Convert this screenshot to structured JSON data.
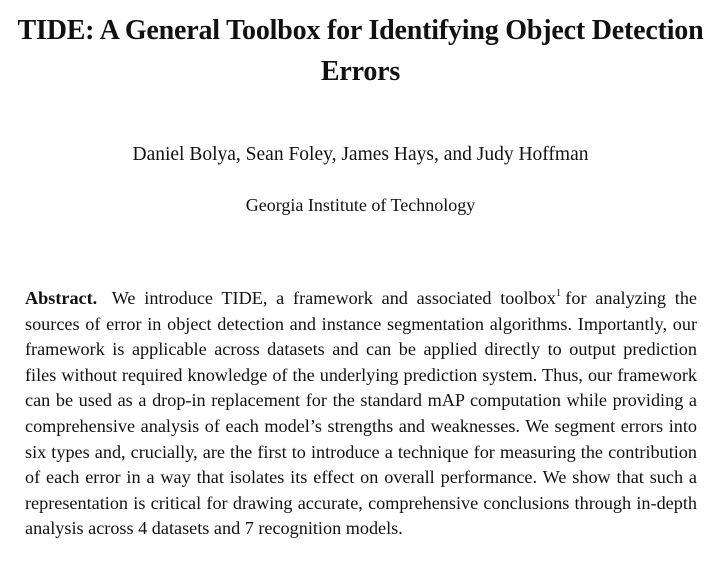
{
  "paper": {
    "title": "TIDE: A General Toolbox for Identifying Object Detection Errors",
    "authors": "Daniel Bolya, Sean Foley, James Hays, and Judy Hoffman",
    "affiliation": "Georgia Institute of Technology",
    "abstract": {
      "label": "Abstract.",
      "text_before_footnote": "We introduce TIDE, a framework and associated toolbox",
      "footnote_mark": "1",
      "text_after_footnote": "for analyzing the sources of error in object detection and instance segmentation algorithms. Importantly, our framework is applicable across datasets and can be applied directly to output prediction files without required knowledge of the underlying prediction system. Thus, our framework can be used as a drop-in replacement for the standard mAP computation while providing a comprehensive analysis of each model’s strengths and weaknesses. We segment errors into six types and, crucially, are the first to introduce a technique for measuring the contribution of each error in a way that isolates its effect on overall performance. We show that such a representation is critical for drawing accurate, comprehensive conclusions through in-depth analysis across 4 datasets and 7 recognition models."
    }
  }
}
